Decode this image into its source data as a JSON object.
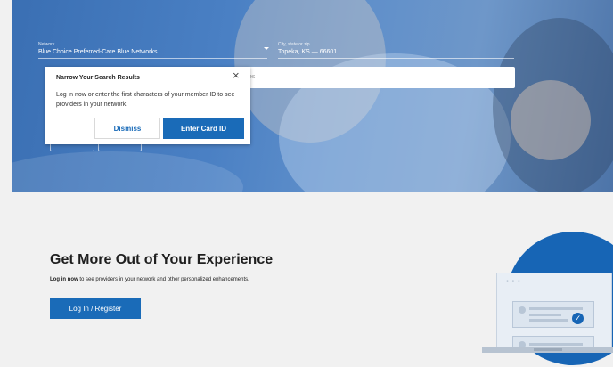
{
  "search": {
    "network_label": "Network",
    "network_value": "Blue Choice Preferred-Care Blue Networks",
    "location_label": "City, state or zip",
    "location_value": "Topeka, KS — 66601",
    "search_placeholder": "alties"
  },
  "popup": {
    "title": "Narrow Your Search Results",
    "message": "Log in now or enter the first characters of your member ID to see providers in your network.",
    "dismiss_label": "Dismiss",
    "enter_label": "Enter Card ID",
    "close_symbol": "×"
  },
  "experience": {
    "heading": "Get More Out of Your Experience",
    "login_link": "Log in now",
    "subtext_rest": " to see providers in your network and other personalized enhancements.",
    "button_label": "Log In / Register"
  },
  "colors": {
    "accent": "#1a6bb8",
    "hero": "#4a80c4",
    "background": "#f1f1f1"
  },
  "icons": {
    "close": "close-icon",
    "dropdown": "chevron-down-icon",
    "check": "check-icon"
  }
}
